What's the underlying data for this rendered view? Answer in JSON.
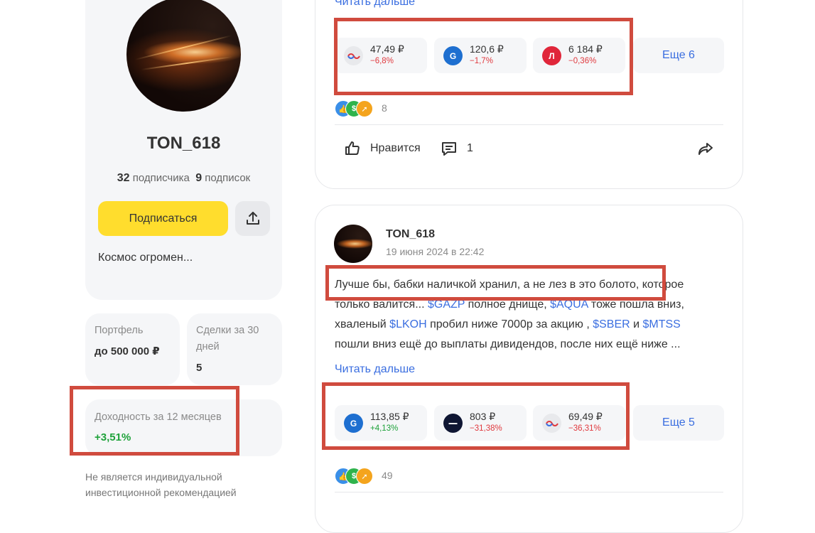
{
  "profile": {
    "name": "TON_618",
    "followers_count": "32",
    "followers_label": "подписчика",
    "following_count": "9",
    "following_label": "подписок",
    "subscribe_label": "Подписаться",
    "bio": "Космос огромен..."
  },
  "stats": {
    "portfolio_label": "Портфель",
    "portfolio_value": "до 500 000 ₽",
    "deals_label": "Сделки за 30 дней",
    "deals_value": "5",
    "yield_label": "Доходность за 12 месяцев",
    "yield_value": "+3,51%"
  },
  "disclaimer": "Не является индивидуальной инвестиционной рекомендацией",
  "posts": [
    {
      "read_more": "Читать дальше",
      "tickers": [
        {
          "price": "47,49 ₽",
          "change": "−6,8%",
          "logo": "aqua-icon",
          "trend": "neg"
        },
        {
          "price": "120,6 ₽",
          "change": "−1,7%",
          "logo": "gazprom-icon",
          "trend": "neg"
        },
        {
          "price": "6 184 ₽",
          "change": "−0,36%",
          "logo": "lukoil-icon",
          "trend": "neg"
        }
      ],
      "more_label": "Еще 6",
      "reactions_count": "8",
      "like_label": "Нравится",
      "comments_count": "1"
    },
    {
      "author": "TON_618",
      "date": "19 июня 2024 в 22:42",
      "text": {
        "line1": "Лучше бы, бабки наличкой хранил,  а не лез в это болото, которое",
        "line2_a": "только валится... ",
        "tag_gazp": "$GAZP",
        "line2_b": " полное днище, ",
        "tag_aqua": "$AQUA",
        "line2_c": " тоже пошла вниз,",
        "line3_a": "хваленый ",
        "tag_lkoh": "$LKOH",
        "line3_b": " пробил ниже 7000р за акцию , ",
        "tag_sber": "$SBER",
        "line3_c": " и ",
        "tag_mtss": "$MTSS",
        "line4": "пошли вниз ещё до выплаты дивидендов,  после них ещё ниже ..."
      },
      "read_more": "Читать дальше",
      "tickers": [
        {
          "price": "113,85 ₽",
          "change": "+4,13%",
          "logo": "gazprom-icon",
          "trend": "pos"
        },
        {
          "price": "803 ₽",
          "change": "−31,38%",
          "logo": "dark-logo-icon",
          "trend": "neg"
        },
        {
          "price": "69,49 ₽",
          "change": "−36,31%",
          "logo": "aqua-icon",
          "trend": "neg"
        }
      ],
      "more_label": "Еще 5",
      "reactions_count": "49"
    }
  ],
  "colors": {
    "accent_yellow": "#ffdd2d",
    "link_blue": "#3a6ee0",
    "negative": "#e0393e",
    "positive": "#1ea23a",
    "highlight": "#d04b3e"
  }
}
